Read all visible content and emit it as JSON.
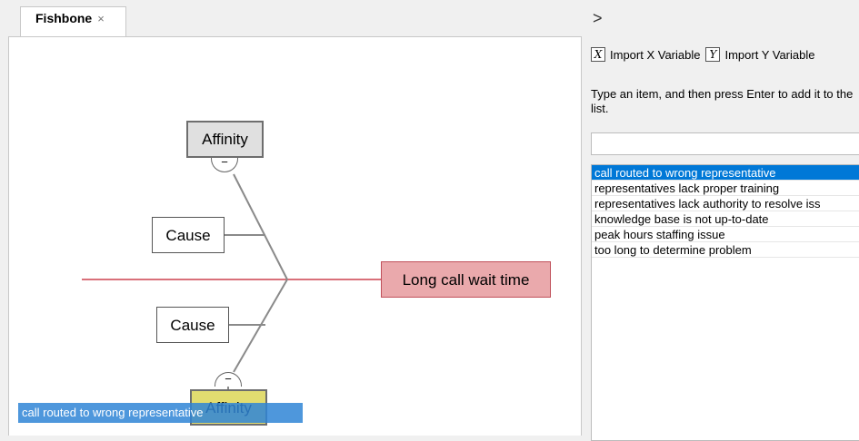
{
  "tabs": [
    {
      "label": "Fishbone",
      "close": "×"
    }
  ],
  "diagram": {
    "effect": "Long call wait time",
    "affinity_top": "Affinity",
    "affinity_bottom": "Affinity",
    "cause_1": "Cause",
    "cause_2": "Cause",
    "collapse_symbol": "−",
    "drag_label": "call routed to wrong representative",
    "colors": {
      "effect_fill": "#eaa9ac",
      "spine": "#d9707a",
      "affinity_bottom_fill": "#e2dc70"
    }
  },
  "panel": {
    "expander": ">",
    "import_x_icon": "X",
    "import_x_label": "Import X Variable",
    "import_y_icon": "Y",
    "import_y_label": "Import Y Variable",
    "instructions": "Type an item, and then press Enter to add it to the list.",
    "input_value": "",
    "items": [
      {
        "label": "call routed to wrong representative",
        "selected": true
      },
      {
        "label": "representatives lack proper training"
      },
      {
        "label": "representatives lack authority to resolve iss"
      },
      {
        "label": "knowledge base is not up-to-date"
      },
      {
        "label": "peak hours staffing issue"
      },
      {
        "label": "too long to determine problem"
      }
    ]
  }
}
